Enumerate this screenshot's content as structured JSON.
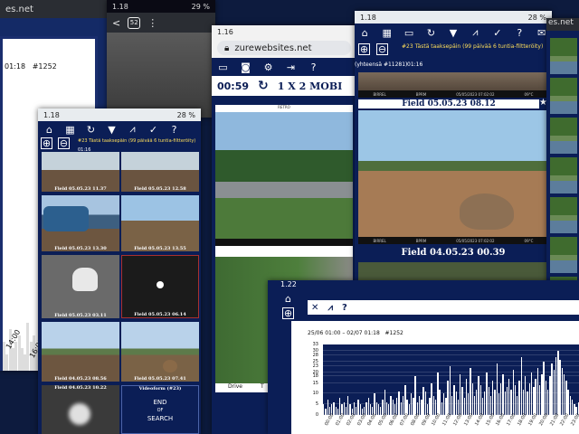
{
  "left_window": {
    "url": "es.net",
    "time_label": "01:18",
    "record_id": "#1252",
    "time_ticks": [
      "14:00",
      "16:00"
    ]
  },
  "top_status": {
    "time": "1.18",
    "battery": "29 %"
  },
  "tabs_count": "52",
  "grid_window": {
    "time": "1.18",
    "battery": "28 %",
    "banner": "#23 Tästä taaksepäin (99 päivää 6 tuntia-filtteröity)",
    "banner_time": "01:16",
    "captions": [
      "Field 05.05.23 11.37",
      "Field 05.05.23 12.58",
      "Field 05.05.23 13.30",
      "Field 05.05.23 13.55",
      "Field 05.05.23 03.11",
      "Field 05.05.23 06.14",
      "Field 04.05.23 08.56",
      "Field 05.05.23 07.41",
      "Field 04.05.23 10.22",
      "Videoform (#23)"
    ],
    "end_label": "END",
    "end_of": "OF",
    "end_search": "SEARCH"
  },
  "center_window": {
    "time": "1.16",
    "url": "zurewebsites.net",
    "countdown": "00:59",
    "mode": "1 X 2 MOBI",
    "photo_top_caption": "RETRO",
    "drive_label": "Drive",
    "drive_label_2": "T"
  },
  "right_window": {
    "time": "1.18",
    "battery": "28 %",
    "banner": "#23 Tästä taaksepäin (99 päivää 6 tuntia-filtteröity)",
    "banner_sub": "(yhteensä #11281)",
    "banner_time": "01:16",
    "strip_left": "BIRREL",
    "strip_mid": "BPRM",
    "strip_date": "05/05/2023 07:02:02",
    "strip_temp": "09°C",
    "caption_1": "Field 05.05.23 08.12",
    "caption_2": "Field 04.05.23 00.39"
  },
  "far_right": {
    "url": "es.net"
  },
  "chart_window": {
    "time": "1.22",
    "range_label": "25/06 01:00 – 02/07 01:18",
    "record_id": "#1252"
  },
  "colors": {
    "navy": "#0b1e56",
    "bar": "#ffffff"
  },
  "chart_data": {
    "type": "bar",
    "ylim": [
      0,
      33
    ],
    "yticks": [
      0,
      5,
      10,
      15,
      18,
      20,
      23,
      25,
      28,
      30,
      33
    ],
    "xticks": [
      "00:00",
      "01:00",
      "02:00",
      "03:00",
      "04:00",
      "05:00",
      "06:00",
      "07:00",
      "08:00",
      "09:00",
      "10:00",
      "11:00",
      "12:00",
      "13:00",
      "14:00",
      "15:00",
      "16:00",
      "17:00",
      "18:00",
      "19:00",
      "20:00",
      "21:00",
      "22:00",
      "23:00"
    ],
    "values": [
      5,
      3,
      7,
      4,
      5,
      6,
      4,
      3,
      8,
      5,
      6,
      4,
      9,
      5,
      3,
      6,
      4,
      7,
      5,
      3,
      4,
      6,
      8,
      5,
      4,
      10,
      6,
      5,
      4,
      7,
      12,
      6,
      5,
      9,
      7,
      5,
      8,
      11,
      6,
      9,
      14,
      7,
      5,
      10,
      8,
      18,
      6,
      9,
      7,
      13,
      11,
      5,
      8,
      15,
      9,
      7,
      20,
      12,
      6,
      10,
      8,
      16,
      23,
      9,
      14,
      11,
      7,
      19,
      13,
      8,
      17,
      10,
      22,
      15,
      9,
      12,
      18,
      14,
      8,
      11,
      20,
      13,
      9,
      16,
      12,
      24,
      10,
      15,
      19,
      11,
      13,
      17,
      12,
      21,
      14,
      9,
      16,
      27,
      12,
      18,
      11,
      15,
      20,
      13,
      17,
      22,
      14,
      19,
      25,
      16,
      12,
      18,
      24,
      21,
      27,
      30,
      26,
      22,
      19,
      16,
      12,
      9,
      7,
      5,
      4,
      6
    ]
  }
}
